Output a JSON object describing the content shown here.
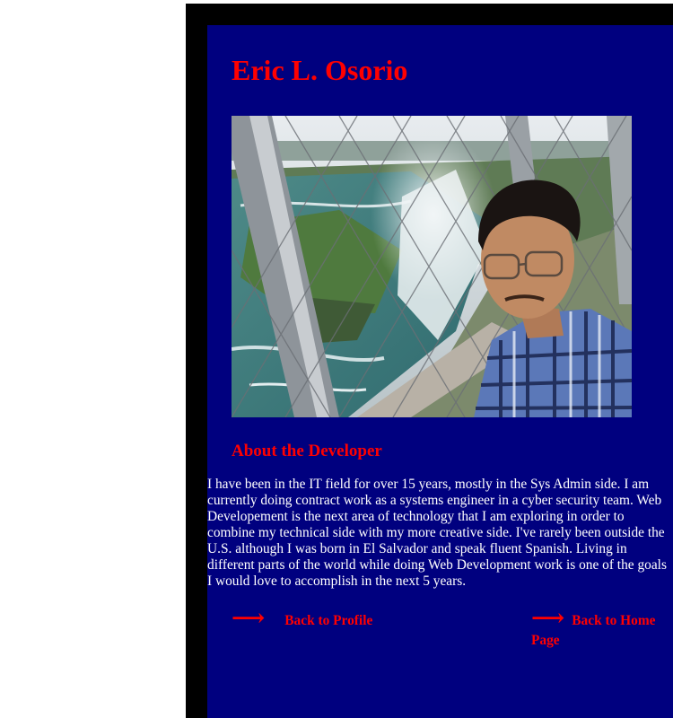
{
  "header": {
    "name": "Eric L. Osorio"
  },
  "photo": {
    "alt": "Eric L. Osorio at Niagara Falls observation deck"
  },
  "about": {
    "heading": "About the Developer",
    "body": "I have been in the IT field for over 15 years, mostly in the Sys Admin side. I am currently doing contract work as a systems engineer in a cyber security team. Web Developement is the next area of technology that I am exploring in order to combine my technical side with my more creative side. I've rarely been outside the U.S. although I was born in El Salvador and speak fluent Spanish. Living in different parts of the world while doing Web Development work is one of the goals I would love to accomplish in the next 5 years."
  },
  "nav": {
    "arrow_glyph": "⟶",
    "back_profile": "Back to Profile",
    "back_home": "Back to Home Page"
  },
  "colors": {
    "page_bg": "#ffffff",
    "frame": "#000000",
    "panel": "#00007f",
    "accent": "#ff0000",
    "text": "#ffffff"
  }
}
